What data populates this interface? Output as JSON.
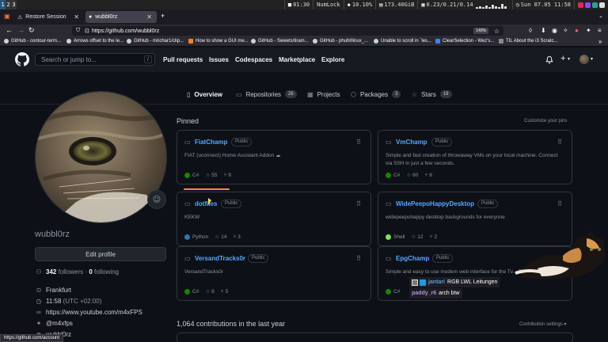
{
  "i3bar": {
    "workspaces": [
      "1",
      "2",
      "3"
    ],
    "window_title": "01:30",
    "numlock": "NumLock",
    "cpu": "10.10%",
    "disk": "173.40GiB",
    "load": "0.23/0.21/0.14",
    "datetime": "Sun 07.05 11:58"
  },
  "browser": {
    "tabs": [
      {
        "label": "Restore Session",
        "active": false
      },
      {
        "label": "wubbl0rz",
        "active": true
      }
    ],
    "url": "https://github.com/wubbl0rz",
    "zoom": "140%",
    "bookmarks": [
      "GitHub - contour-term...",
      "Arrows offset to the le...",
      "GitHub - mrichar1/clip...",
      "How to show a GUI me...",
      "GitHub - Sweets/tiram...",
      "GitHub - phuhl/linux_...",
      "Unable to scroll in `les...",
      "ClearSelection - Wez's...",
      "TIL About the i3 Scratc..."
    ]
  },
  "github": {
    "search_placeholder": "Search or jump to...",
    "slash": "/",
    "nav": [
      "Pull requests",
      "Issues",
      "Codespaces",
      "Marketplace",
      "Explore"
    ],
    "notif_icon": "bell-icon",
    "plus_icon": "plus-icon"
  },
  "profile_tabs": [
    {
      "label": "Overview",
      "count": null
    },
    {
      "label": "Repositories",
      "count": "26"
    },
    {
      "label": "Projects",
      "count": null
    },
    {
      "label": "Packages",
      "count": "3"
    },
    {
      "label": "Stars",
      "count": "19"
    }
  ],
  "profile": {
    "username": "wubbl0rz",
    "edit_label": "Edit profile",
    "followers_count": "342",
    "followers_label": "followers",
    "sep": "·",
    "following_count": "0",
    "following_label": "following",
    "location": "Frankfurt",
    "time": "11:58",
    "tz": "(UTC +02:00)",
    "website": "https://www.youtube.com/m4xFPS",
    "twitter": "@m4xfps",
    "other": "wubbl0rz"
  },
  "pinned": {
    "title": "Pinned",
    "customize": "Customize your pins",
    "public_label": "Public",
    "repos": [
      {
        "name": "FiatChamp",
        "desc": "FIAT (uconnect) Home Assistant Addon ☁",
        "lang": "C#",
        "color": "#178600",
        "stars": "55",
        "forks": "9"
      },
      {
        "name": "VmChamp",
        "desc": "Simple and fast creation of throwaway VMs on your local machine. Connect via SSH in just a few seconds.",
        "lang": "C#",
        "color": "#178600",
        "stars": "60",
        "forks": "8"
      },
      {
        "name": "dotfiles",
        "desc": "KEKW",
        "lang": "Python",
        "color": "#3572A5",
        "stars": "14",
        "forks": "3"
      },
      {
        "name": "WidePeepoHappyDesktop",
        "desc": "widepeepohappy desktop backgrounds for everyone",
        "lang": "Shell",
        "color": "#89e051",
        "stars": "12",
        "forks": "2"
      },
      {
        "name": "VersandTracks0r",
        "desc": "VersandTracks0r",
        "lang": "C#",
        "color": "#178600",
        "stars": "8",
        "forks": "5"
      },
      {
        "name": "EpgChamp",
        "desc": "Simple and easy to use modern web interface for the Tv... EPG Supports r...",
        "lang": "C#",
        "color": "#178600",
        "stars": "",
        "forks": ""
      }
    ]
  },
  "contributions": {
    "title": "1,064 contributions in the last year",
    "settings": "Contribution settings ▾"
  },
  "statusbar": {
    "url": "https://github.com/account"
  },
  "chat": [
    {
      "user": "jantari",
      "msg": "RGB LWL Leitungen",
      "color": "#5b9bd5"
    },
    {
      "user": "paddy_r6",
      "msg": "arch btw",
      "color": "#b48ee0"
    }
  ]
}
